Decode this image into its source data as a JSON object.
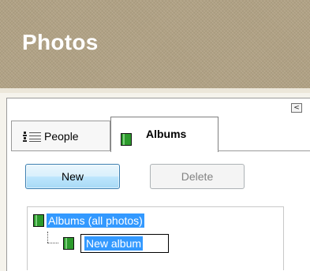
{
  "header": {
    "title": "Photos"
  },
  "panel": {
    "collapse_glyph": "<"
  },
  "tabs": [
    {
      "label": "People",
      "icon": "people-list-icon",
      "selected": false
    },
    {
      "label": "Albums",
      "icon": "album-book-icon",
      "selected": true
    }
  ],
  "toolbar": {
    "new_label": "New",
    "delete_label": "Delete",
    "delete_enabled": false
  },
  "tree": {
    "root_label": "Albums (all photos)",
    "child_label": "New album"
  },
  "colors": {
    "header": "#b0a184",
    "selection": "#3399ff",
    "album_icon": "#2c9a2c"
  }
}
